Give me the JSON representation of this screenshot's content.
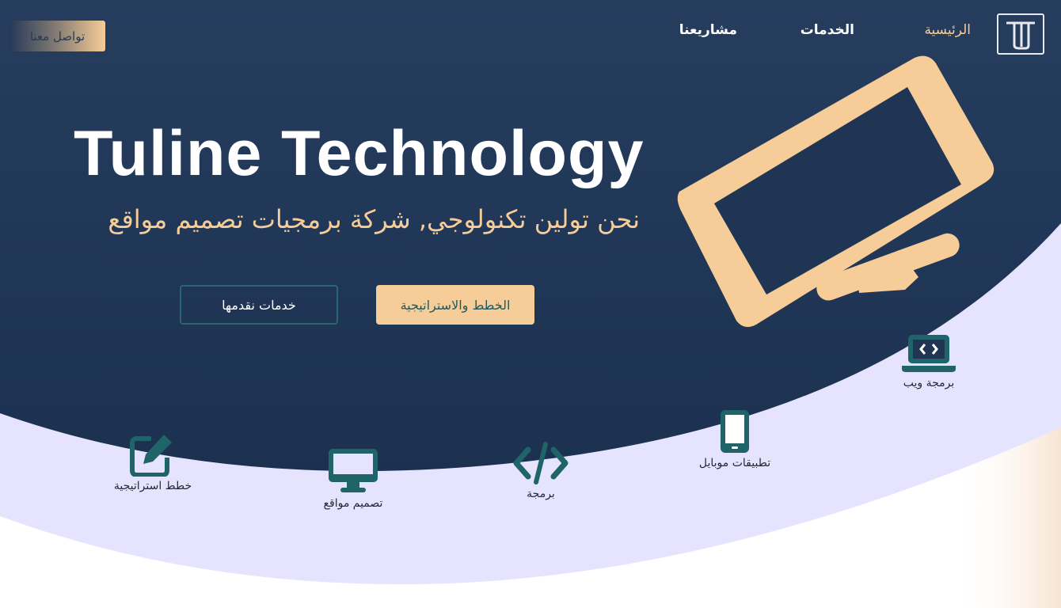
{
  "header": {
    "logo_text": "TU",
    "nav": [
      {
        "label": "الرئيسية"
      },
      {
        "label": "الخدمات"
      },
      {
        "label": "مشاريعنا"
      }
    ],
    "contact_label": "تواصل معنا"
  },
  "hero": {
    "title": "Tuline Technology",
    "subtitle": "نحن تولين تكنولوجي, شركة برمجيات تصميم مواقع",
    "primary_button": "الخطط والاستراتيجية",
    "secondary_button": "خدمات نقدمها"
  },
  "services": [
    {
      "label": "برمجة ويب",
      "icon": "laptop-code-icon"
    },
    {
      "label": "تطبيقات موبايل",
      "icon": "mobile-icon"
    },
    {
      "label": "برمجة",
      "icon": "code-icon"
    },
    {
      "label": "تصميم مواقع",
      "icon": "desktop-icon"
    },
    {
      "label": "خطط استراتيجية",
      "icon": "edit-icon"
    }
  ],
  "colors": {
    "navy": "#1f3553",
    "accent": "#f6cc98",
    "teal": "#1f6468",
    "lavender": "#e8e5ff"
  }
}
